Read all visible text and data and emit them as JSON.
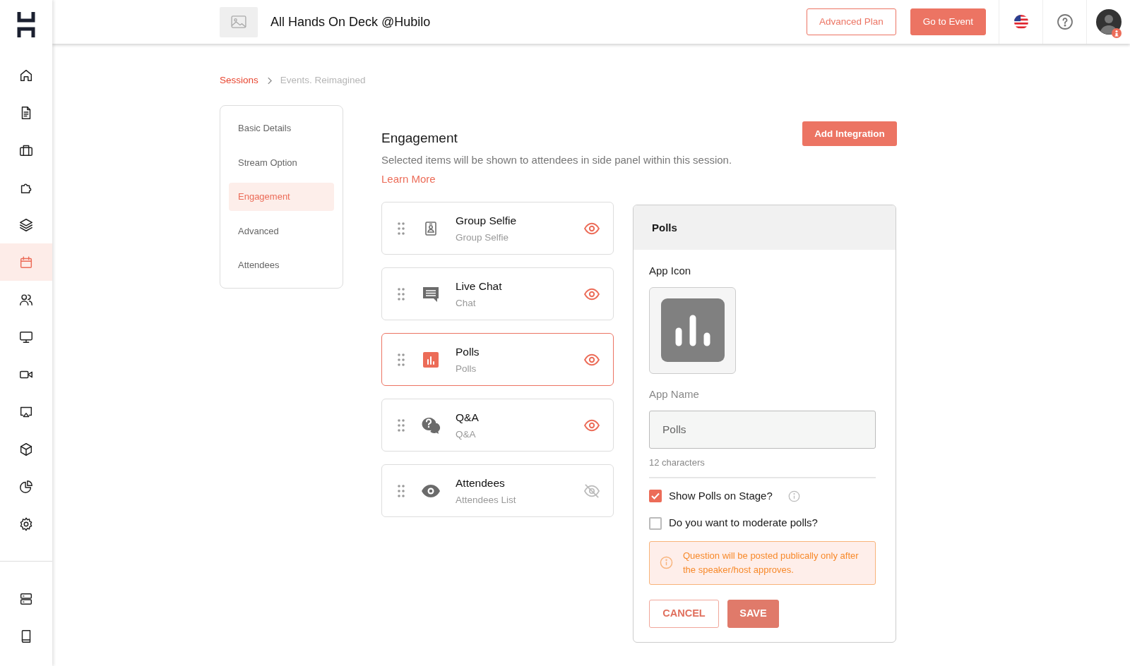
{
  "sidebar": {
    "items": [
      {
        "kind": "home",
        "selected": false
      },
      {
        "kind": "document",
        "selected": false
      },
      {
        "kind": "briefcase",
        "selected": false
      },
      {
        "kind": "puzzle",
        "selected": false
      },
      {
        "kind": "layers",
        "selected": false
      },
      {
        "kind": "calendar",
        "selected": true
      },
      {
        "kind": "users",
        "selected": false
      },
      {
        "kind": "monitor",
        "selected": false
      },
      {
        "kind": "video",
        "selected": false
      },
      {
        "kind": "screen-share",
        "selected": false
      },
      {
        "kind": "cube",
        "selected": false
      },
      {
        "kind": "pie",
        "selected": false
      },
      {
        "kind": "gear",
        "selected": false
      }
    ],
    "bottom_items": [
      {
        "kind": "server"
      },
      {
        "kind": "book"
      }
    ]
  },
  "header": {
    "event_title": "All Hands On Deck @Hubilo",
    "buttons": [
      {
        "label": "Advanced Plan",
        "kind": "outline"
      },
      {
        "label": "Go to Event",
        "kind": "filled"
      }
    ]
  },
  "breadcrumb": [
    {
      "label": "Sessions",
      "kind": "link"
    },
    {
      "label": "Events. Reimagined",
      "kind": "current"
    }
  ],
  "section_nav": [
    {
      "label": "Basic Details",
      "selected": false
    },
    {
      "label": "Stream Option",
      "selected": false
    },
    {
      "label": "Engagement",
      "selected": true
    },
    {
      "label": "Advanced",
      "selected": false
    },
    {
      "label": "Attendees",
      "selected": false
    }
  ],
  "engagement": {
    "title": "Engagement",
    "description": "Selected items will be shown to attendees in side panel within this session.",
    "learn_more": "Learn More",
    "add_button": "Add Integration",
    "apps": [
      {
        "kind": "selfie",
        "title": "Group Selfie",
        "subtitle": "Group Selfie",
        "selected": false,
        "visible": true
      },
      {
        "kind": "chat",
        "title": "Live Chat",
        "subtitle": "Chat",
        "selected": false,
        "visible": true
      },
      {
        "kind": "polls",
        "title": "Polls",
        "subtitle": "Polls",
        "selected": true,
        "visible": true
      },
      {
        "kind": "qa",
        "title": "Q&A",
        "subtitle": "Q&A",
        "selected": false,
        "visible": true
      },
      {
        "kind": "eye",
        "title": "Attendees",
        "subtitle": "Attendees List",
        "selected": false,
        "visible": false
      }
    ]
  },
  "app_panel": {
    "title": "Polls",
    "app_icon_label": "App Icon",
    "app_name_label": "App Name",
    "app_name_value": "Polls",
    "char_count": "12 characters",
    "options": [
      {
        "label": "Show Polls on Stage?",
        "checked": true,
        "info": true
      },
      {
        "label": "Do you want to moderate polls?",
        "checked": false,
        "info": false
      }
    ],
    "notice": "Question will be posted publically only after the speaker/host approves.",
    "buttons": [
      {
        "label": "CANCEL",
        "kind": "outline"
      },
      {
        "label": "SAVE",
        "kind": "filled"
      }
    ]
  }
}
